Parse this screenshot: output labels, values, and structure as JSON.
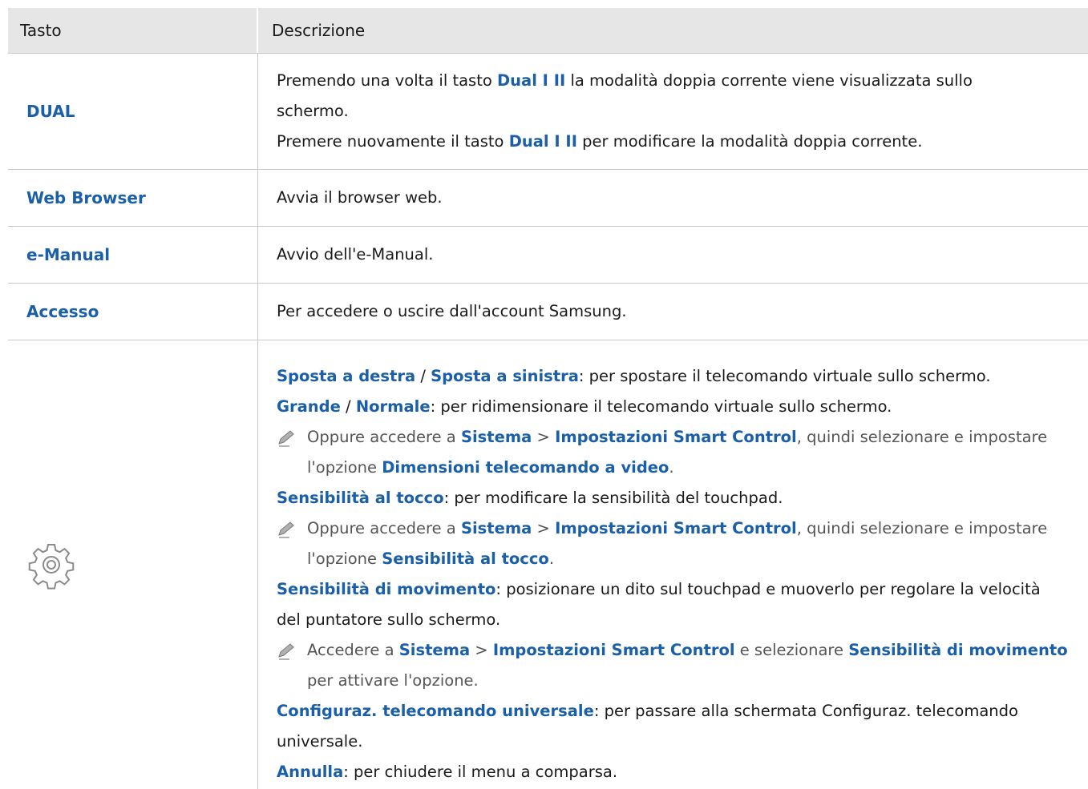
{
  "header": {
    "col_key": "Tasto",
    "col_desc": "Descrizione"
  },
  "rows": {
    "dual": {
      "key": "DUAL",
      "l1_pre": "Premendo una volta il tasto ",
      "l1_b": "Dual I II",
      "l1_post": " la modalità doppia corrente viene visualizzata sullo",
      "l2": "schermo.",
      "l3_pre": "Premere nuovamente il tasto ",
      "l3_b": "Dual I II",
      "l3_post": " per modificare la modalità doppia corrente."
    },
    "web": {
      "key": "Web Browser",
      "desc": "Avvia il browser web."
    },
    "emanual": {
      "key": "e-Manual",
      "desc": "Avvio dell'e-Manual."
    },
    "accesso": {
      "key": "Accesso",
      "desc": "Per accedere o uscire dall'account Samsung."
    },
    "settings": {
      "icon": "gear-icon",
      "a1": "Sposta a destra",
      "a_sep": " / ",
      "a2": "Sposta a sinistra",
      "a_post": ": per spostare il telecomando virtuale sullo schermo.",
      "b1": "Grande",
      "b_sep": " / ",
      "b2": "Normale",
      "b_post": ": per ridimensionare il telecomando virtuale sullo schermo.",
      "n1_pre": "Oppure accedere a ",
      "n1_b1": "Sistema",
      "n1_gt": " > ",
      "n1_b2": "Impostazioni Smart Control",
      "n1_post": ", quindi selezionare e impostare",
      "n1_l2_pre": "l'opzione ",
      "n1_l2_b": "Dimensioni telecomando a video",
      "n1_l2_post": ".",
      "c1": "Sensibilità al tocco",
      "c_post": ": per modificare la sensibilità del touchpad.",
      "n2_pre": "Oppure accedere a ",
      "n2_b1": "Sistema",
      "n2_gt": " > ",
      "n2_b2": "Impostazioni Smart Control",
      "n2_post": ", quindi selezionare e impostare",
      "n2_l2_pre": "l'opzione ",
      "n2_l2_b": "Sensibilità al tocco",
      "n2_l2_post": ".",
      "d1": "Sensibilità di movimento",
      "d_post": ": posizionare un dito sul touchpad e muoverlo per regolare la velocità",
      "d_l2": "del puntatore sullo schermo.",
      "n3_pre": "Accedere a ",
      "n3_b1": "Sistema",
      "n3_gt": " > ",
      "n3_b2": "Impostazioni Smart Control",
      "n3_mid": " e selezionare ",
      "n3_b3": "Sensibilità di movimento",
      "n3_l2": "per attivare l'opzione.",
      "e1": "Configuraz. telecomando universale",
      "e_post": ": per passare alla schermata Configuraz. telecomando",
      "e_l2": "universale.",
      "f1": "Annulla",
      "f_post": ": per chiudere il menu a comparsa."
    }
  }
}
